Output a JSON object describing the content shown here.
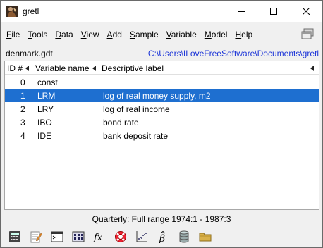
{
  "window": {
    "title": "gretl"
  },
  "menu": [
    {
      "mn": "F",
      "rest": "ile"
    },
    {
      "mn": "T",
      "rest": "ools"
    },
    {
      "mn": "D",
      "rest": "ata"
    },
    {
      "mn": "V",
      "rest": "iew"
    },
    {
      "mn": "A",
      "rest": "dd"
    },
    {
      "mn": "S",
      "rest": "ample"
    },
    {
      "mn": "V",
      "rest": "ariable"
    },
    {
      "mn": "M",
      "rest": "odel"
    },
    {
      "mn": "H",
      "rest": "elp"
    }
  ],
  "dataset": {
    "name": "denmark.gdt",
    "path": "C:\\Users\\ILoveFreeSoftware\\Documents\\gretl"
  },
  "columns": {
    "id": "ID #",
    "name": "Variable name",
    "label": "Descriptive label"
  },
  "rows": [
    {
      "id": "0",
      "name": "const",
      "label": ""
    },
    {
      "id": "1",
      "name": "LRM",
      "label": "log of real money supply, m2"
    },
    {
      "id": "2",
      "name": "LRY",
      "label": "log of real income"
    },
    {
      "id": "3",
      "name": "IBO",
      "label": "bond rate"
    },
    {
      "id": "4",
      "name": "IDE",
      "label": "bank deposit rate"
    }
  ],
  "selected_row": 1,
  "status": "Quarterly: Full range 1974:1 - 1987:3",
  "toolbar": [
    "calculator-icon",
    "script-editor-icon",
    "terminal-icon",
    "session-icon-view-icon",
    "function-fx-icon",
    "help-lifebuoy-icon",
    "scatter-plot-icon",
    "beta-hat-model-icon",
    "database-icon",
    "folder-icon"
  ],
  "colors": {
    "selection": "#1e6fd0",
    "path_link": "#1d36d8"
  }
}
